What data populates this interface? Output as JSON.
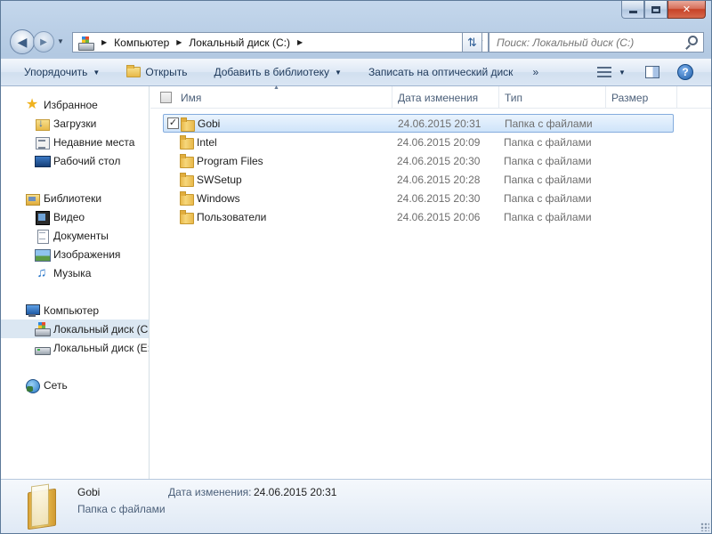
{
  "window": {
    "controls": {
      "minimize": "",
      "maximize": "",
      "close": "✕"
    }
  },
  "nav": {
    "back_icon": "arrow-left-icon",
    "forward_icon": "arrow-right-icon",
    "address": {
      "crumbs": [
        "Компьютер",
        "Локальный диск (C:)"
      ]
    },
    "search_placeholder": "Поиск: Локальный диск (C:)"
  },
  "toolbar": {
    "organize": "Упорядочить",
    "open": "Открыть",
    "add_to_library": "Добавить в библиотеку",
    "burn": "Записать на оптический диск",
    "more": "»",
    "help": "?"
  },
  "sidebar": {
    "favorites": {
      "label": "Избранное",
      "icon": "star-icon"
    },
    "favorites_items": [
      {
        "label": "Загрузки",
        "icon": "downloads-icon"
      },
      {
        "label": "Недавние места",
        "icon": "recent-places-icon"
      },
      {
        "label": "Рабочий стол",
        "icon": "desktop-icon"
      }
    ],
    "libraries": {
      "label": "Библиотеки",
      "icon": "library-icon"
    },
    "libraries_items": [
      {
        "label": "Видео",
        "icon": "video-icon"
      },
      {
        "label": "Документы",
        "icon": "documents-icon"
      },
      {
        "label": "Изображения",
        "icon": "pictures-icon"
      },
      {
        "label": "Музыка",
        "icon": "music-icon"
      }
    ],
    "computer": {
      "label": "Компьютер",
      "icon": "computer-icon"
    },
    "computer_items": [
      {
        "label": "Локальный диск (C",
        "icon": "windows-drive-icon",
        "selected": true
      },
      {
        "label": "Локальный диск (E:",
        "icon": "drive-icon"
      }
    ],
    "network": {
      "label": "Сеть",
      "icon": "network-icon"
    }
  },
  "columns": {
    "name": "Имя",
    "date": "Дата изменения",
    "type": "Тип",
    "size": "Размер"
  },
  "files": [
    {
      "name": "Gobi",
      "date": "24.06.2015 20:31",
      "type": "Папка с файлами",
      "selected": true,
      "checked": true
    },
    {
      "name": "Intel",
      "date": "24.06.2015 20:09",
      "type": "Папка с файлами"
    },
    {
      "name": "Program Files",
      "date": "24.06.2015 20:30",
      "type": "Папка с файлами"
    },
    {
      "name": "SWSetup",
      "date": "24.06.2015 20:28",
      "type": "Папка с файлами"
    },
    {
      "name": "Windows",
      "date": "24.06.2015 20:30",
      "type": "Папка с файлами"
    },
    {
      "name": "Пользователи",
      "date": "24.06.2015 20:06",
      "type": "Папка с файлами"
    }
  ],
  "details": {
    "name": "Gobi",
    "type": "Папка с файлами",
    "date_label": "Дата изменения:",
    "date_value": "24.06.2015 20:31"
  }
}
